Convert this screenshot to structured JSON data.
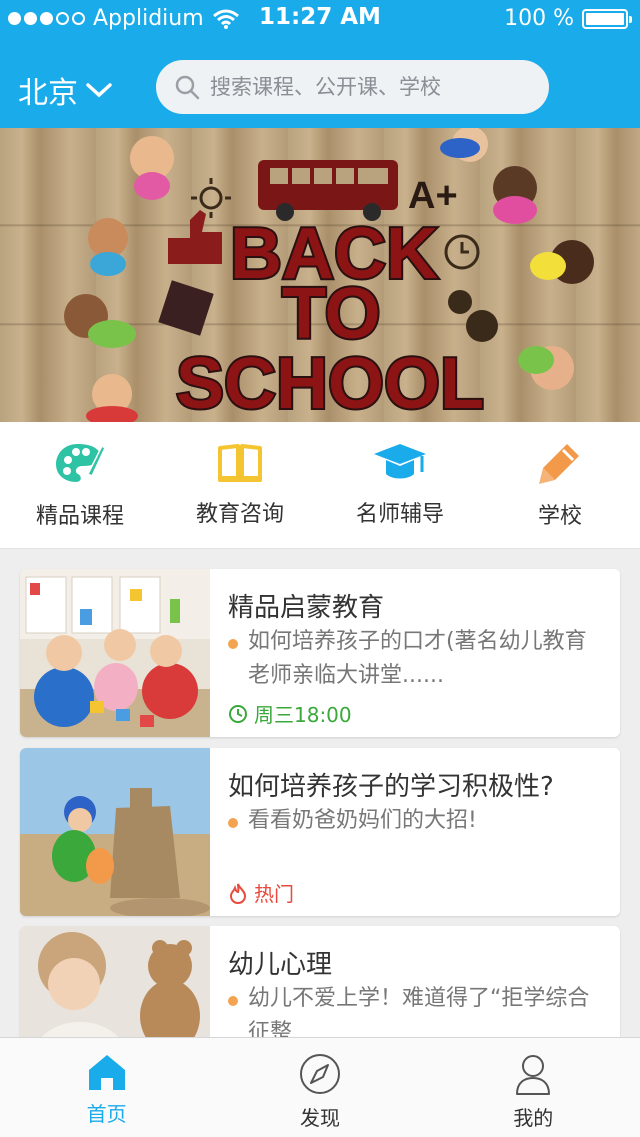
{
  "status_bar": {
    "carrier": "Applidium",
    "time": "11:27 AM",
    "battery": "100 %",
    "signal_bars": 5,
    "signal_filled": 3
  },
  "header": {
    "city": "北京",
    "search_placeholder": "搜索课程、公开课、学校",
    "background_color": "#1aabeb"
  },
  "banner": {
    "headline_lines": [
      "BACK",
      "TO",
      "SCHOOL"
    ],
    "badge": "A+"
  },
  "categories": [
    {
      "label": "精品课程",
      "icon": "palette-icon",
      "color": "#2fc3a6"
    },
    {
      "label": "教育咨询",
      "icon": "book-icon",
      "color": "#f5c531"
    },
    {
      "label": "名师辅导",
      "icon": "graduation-cap-icon",
      "color": "#1aabeb"
    },
    {
      "label": "学校",
      "icon": "pencil-icon",
      "color": "#f39a4a"
    }
  ],
  "cards": [
    {
      "title": "精品启蒙教育",
      "desc": "如何培养孩子的口才(著名幼儿教育老师亲临大讲堂......",
      "meta": "周三18:00",
      "meta_icon": "clock-icon",
      "meta_color": "#3aa83a"
    },
    {
      "title": "如何培养孩子的学习积极性?",
      "desc": "看看奶爸奶妈们的大招!",
      "meta": "热门",
      "meta_icon": "flame-icon",
      "meta_color": "#e84a3d"
    },
    {
      "title": "幼儿心理",
      "desc": "幼儿不爱上学！难道得了“拒学综合征整",
      "meta": "",
      "meta_icon": "",
      "meta_color": "#3aa83a"
    }
  ],
  "tabs": [
    {
      "label": "首页",
      "icon": "home-icon",
      "active": true
    },
    {
      "label": "发现",
      "icon": "compass-icon",
      "active": false
    },
    {
      "label": "我的",
      "icon": "person-icon",
      "active": false
    }
  ],
  "accent_color": "#1aabeb"
}
